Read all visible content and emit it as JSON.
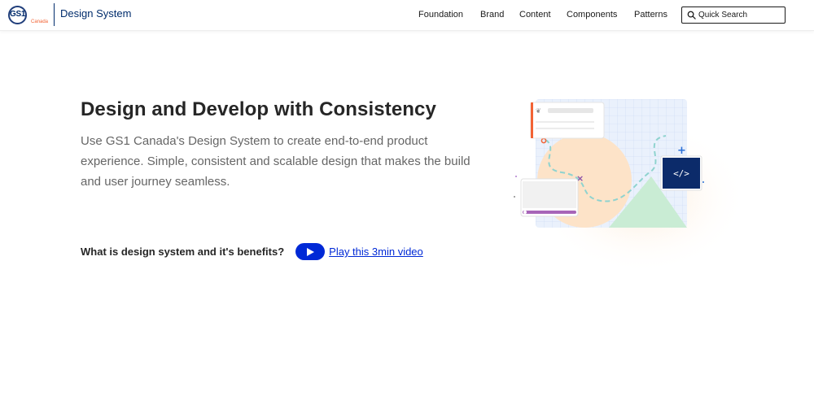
{
  "header": {
    "logo": {
      "brand": "GS1",
      "country": "Canada"
    },
    "title": "Design System"
  },
  "nav": {
    "items": [
      {
        "label": "Foundation"
      },
      {
        "label": "Brand"
      },
      {
        "label": "Content"
      },
      {
        "label": "Components"
      },
      {
        "label": "Patterns"
      }
    ]
  },
  "search": {
    "label": "Quick Search",
    "icon": "search-icon"
  },
  "hero": {
    "title": "Design and Develop with Consistency",
    "description": "Use GS1 Canada's Design System to create end-to-end product experience. Simple, consistent and scalable design that makes the build and user journey seamless.",
    "video_question": "What is design system and it's benefits?",
    "video_link": "Play this 3min video",
    "play_icon": "play-icon",
    "code_glyph": "</>"
  },
  "colors": {
    "brand_navy": "#002c6c",
    "accent_orange": "#f26334",
    "link_blue": "#0029d6"
  }
}
